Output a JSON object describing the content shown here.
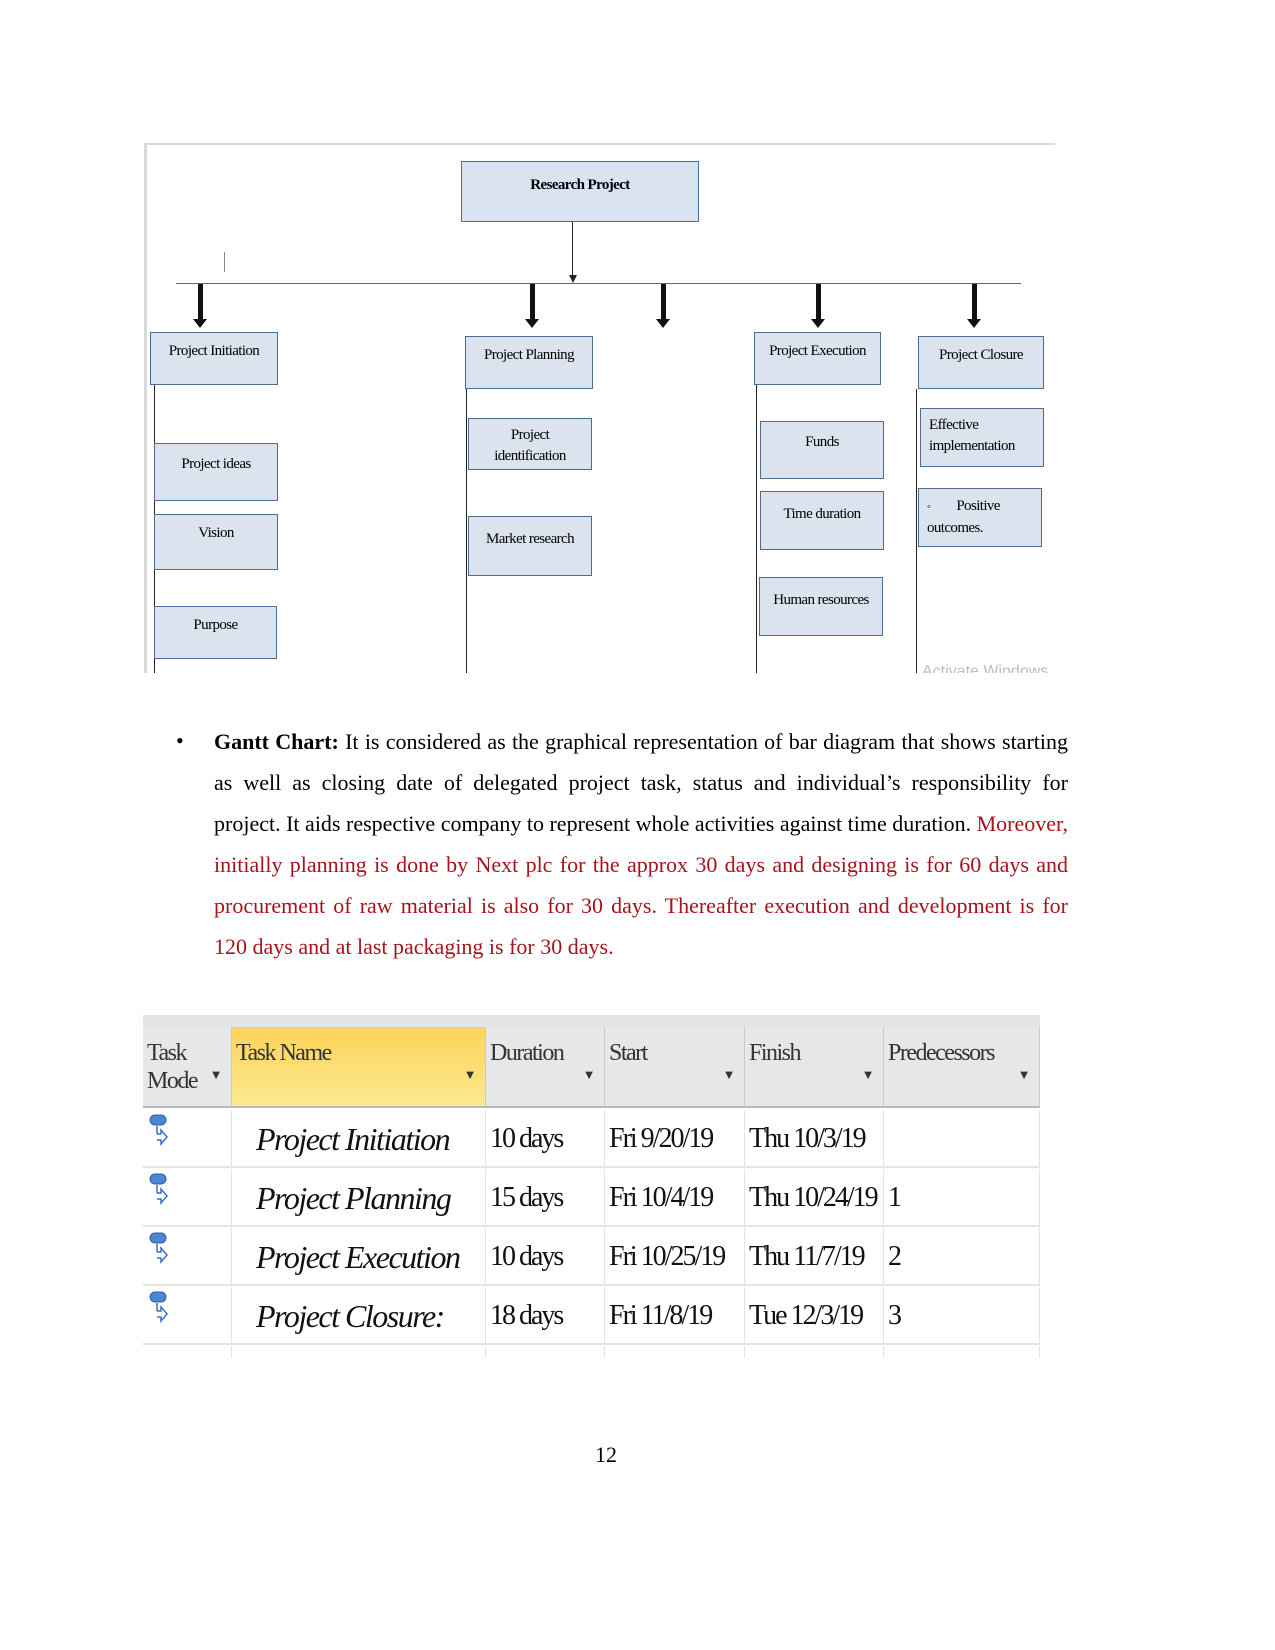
{
  "diagram": {
    "root": "Research Project",
    "branches": [
      {
        "title": "Project Initiation",
        "children": [
          "Project ideas",
          "Vision",
          "Purpose"
        ]
      },
      {
        "title": "Project Planning",
        "children": [
          "Project identification",
          "Market research"
        ]
      },
      {
        "title": "Project Execution",
        "children": [
          "Funds",
          "Time duration",
          "Human resources"
        ]
      },
      {
        "title": "Project Closure",
        "children": [
          "Effective implementation",
          "Positive outcomes."
        ]
      }
    ],
    "positive_bullet": "◦",
    "watermark": "Activate Windows",
    "colors": {
      "box_fill": "#dbe3ee",
      "box_border": "#4f6d8f"
    }
  },
  "paragraph": {
    "bullet": "•",
    "term": "Gantt Chart:",
    "text": " It is considered as the graphical representation of bar diagram that shows starting as well as closing date of delegated project task, status and individual’s responsibility for project. It aids respective company to represent whole activities against time duration.  ",
    "highlight": "Moreover, initially planning is done by Next plc for the approx 30 days and designing is for 60 days and procurement of raw material is also for 30 days. Thereafter execution and development is for 120 days and at last packaging is for 30 days.",
    "highlight_color": "#a5141c"
  },
  "gantt_table": {
    "columns": [
      "Task Mode",
      "Task Name",
      "Duration",
      "Start",
      "Finish",
      "Predecessors"
    ],
    "rows": [
      {
        "task_mode": "auto-scheduled-icon",
        "name": "Project Initiation",
        "duration": "10 days",
        "start": "Fri 9/20/19",
        "finish": "Thu 10/3/19",
        "predecessors": ""
      },
      {
        "task_mode": "auto-scheduled-icon",
        "name": "Project Planning",
        "duration": "15 days",
        "start": "Fri 10/4/19",
        "finish": "Thu 10/24/19",
        "predecessors": "1"
      },
      {
        "task_mode": "auto-scheduled-icon",
        "name": "Project Execution",
        "duration": "10 days",
        "start": "Fri 10/25/19",
        "finish": "Thu 11/7/19",
        "predecessors": "2"
      },
      {
        "task_mode": "auto-scheduled-icon",
        "name": "Project Closure:",
        "duration": "18 days",
        "start": "Fri 11/8/19",
        "finish": "Tue 12/3/19",
        "predecessors": "3"
      }
    ],
    "selected_column": "Task Name"
  },
  "page_number": "12"
}
